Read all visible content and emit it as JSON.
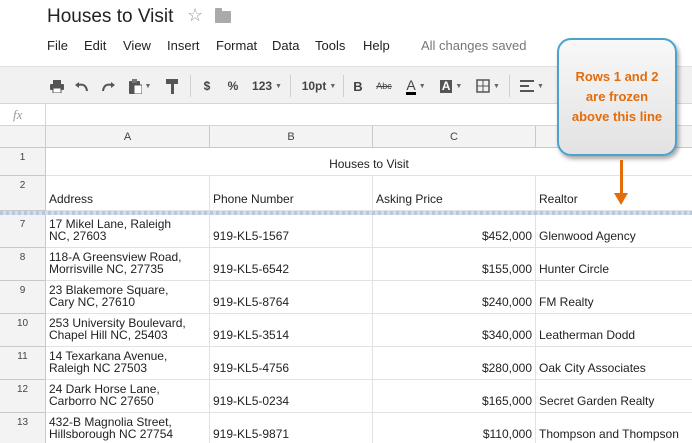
{
  "doc": {
    "title": "Houses to Visit"
  },
  "menu": [
    "File",
    "Edit",
    "View",
    "Insert",
    "Format",
    "Data",
    "Tools",
    "Help"
  ],
  "save_status": "All changes saved",
  "toolbar": {
    "currency": "$",
    "percent": "%",
    "number_format": "123",
    "font_size": "10pt",
    "bold": "B",
    "strike": "Abc",
    "text_color": "A",
    "fill_color": "A"
  },
  "formula": {
    "icon": "fx",
    "value": ""
  },
  "columns": [
    "A",
    "B",
    "C"
  ],
  "rows": [
    {
      "num": "1",
      "cells": [
        "",
        "",
        "Houses to Visit",
        ""
      ]
    },
    {
      "num": "2",
      "cells": [
        "Address",
        "Phone Number",
        "Asking Price",
        "Realtor"
      ]
    },
    {
      "num": "7",
      "cells": [
        "17 Mikel Lane, Raleigh",
        "NC, 27603",
        "919-KL5-1567",
        "$452,000",
        "Glenwood Agency"
      ]
    },
    {
      "num": "8",
      "cells": [
        "118-A Greensview Road,",
        "Morrisville NC, 27735",
        "919-KL5-6542",
        "$155,000",
        "Hunter Circle"
      ]
    },
    {
      "num": "9",
      "cells": [
        "23 Blakemore Square,",
        "Cary NC, 27610",
        "919-KL5-8764",
        "$240,000",
        "FM Realty"
      ]
    },
    {
      "num": "10",
      "cells": [
        "253 University Boulevard,",
        "Chapel Hill NC, 25403",
        "919-KL5-3514",
        "$340,000",
        "Leatherman Dodd"
      ]
    },
    {
      "num": "11",
      "cells": [
        "14 Texarkana Avenue,",
        "Raleigh NC 27503",
        "919-KL5-4756",
        "$280,000",
        "Oak City Associates"
      ]
    },
    {
      "num": "12",
      "cells": [
        "24 Dark Horse Lane,",
        "Carborro NC 27650",
        "919-KL5-0234",
        "$165,000",
        "Secret Garden Realty"
      ]
    },
    {
      "num": "13",
      "cells": [
        "432-B Magnolia Street,",
        "Hillsborough NC 27754",
        "919-KL5-9871",
        "$110,000",
        "Thompson and Thompson"
      ]
    }
  ],
  "callout": {
    "text": "Rows 1 and 2\nare frozen\nabove this line"
  },
  "colors": {
    "accent_orange": "#e46c0a",
    "callout_border": "#4ca2cc"
  }
}
